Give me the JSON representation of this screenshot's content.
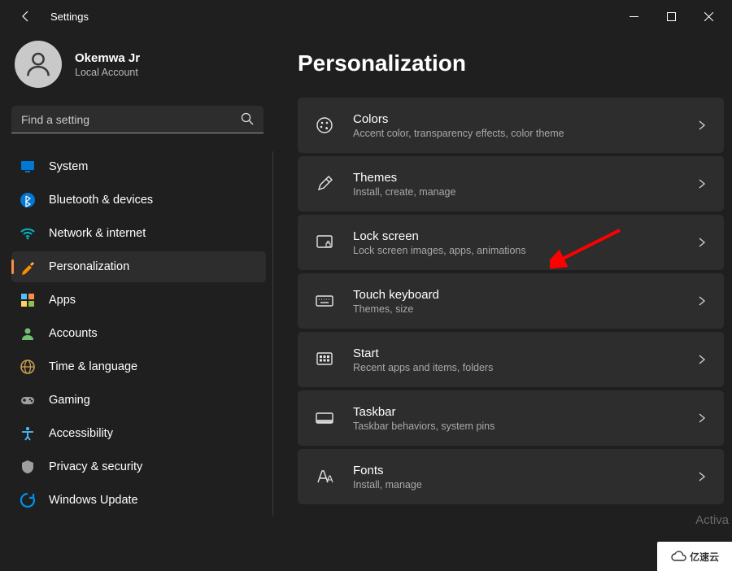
{
  "titlebar": {
    "title": "Settings"
  },
  "profile": {
    "name": "Okemwa Jr",
    "account_type": "Local Account"
  },
  "search": {
    "placeholder": "Find a setting"
  },
  "sidebar": {
    "items": [
      {
        "label": "System",
        "icon": "monitor",
        "color": "#0078d4"
      },
      {
        "label": "Bluetooth & devices",
        "icon": "bluetooth",
        "color": "#0078d4"
      },
      {
        "label": "Network & internet",
        "icon": "wifi",
        "color": "#00b7c3"
      },
      {
        "label": "Personalization",
        "icon": "brush",
        "color": "#ff8c00",
        "active": true
      },
      {
        "label": "Apps",
        "icon": "apps",
        "color": "#4cc2ff"
      },
      {
        "label": "Accounts",
        "icon": "person",
        "color": "#70c070"
      },
      {
        "label": "Time & language",
        "icon": "globe",
        "color": "#c9a050"
      },
      {
        "label": "Gaming",
        "icon": "gamepad",
        "color": "#9e9e9e"
      },
      {
        "label": "Accessibility",
        "icon": "accessibility",
        "color": "#4cc2ff"
      },
      {
        "label": "Privacy & security",
        "icon": "shield",
        "color": "#9e9e9e"
      },
      {
        "label": "Windows Update",
        "icon": "update",
        "color": "#0091ea"
      }
    ]
  },
  "page": {
    "title": "Personalization",
    "tiles": [
      {
        "title": "Colors",
        "subtitle": "Accent color, transparency effects, color theme",
        "icon": "palette"
      },
      {
        "title": "Themes",
        "subtitle": "Install, create, manage",
        "icon": "pen"
      },
      {
        "title": "Lock screen",
        "subtitle": "Lock screen images, apps, animations",
        "icon": "lock-screen"
      },
      {
        "title": "Touch keyboard",
        "subtitle": "Themes, size",
        "icon": "keyboard"
      },
      {
        "title": "Start",
        "subtitle": "Recent apps and items, folders",
        "icon": "start"
      },
      {
        "title": "Taskbar",
        "subtitle": "Taskbar behaviors, system pins",
        "icon": "taskbar"
      },
      {
        "title": "Fonts",
        "subtitle": "Install, manage",
        "icon": "fonts"
      }
    ]
  },
  "watermark": {
    "activate": "Activa",
    "brand": "亿速云"
  }
}
